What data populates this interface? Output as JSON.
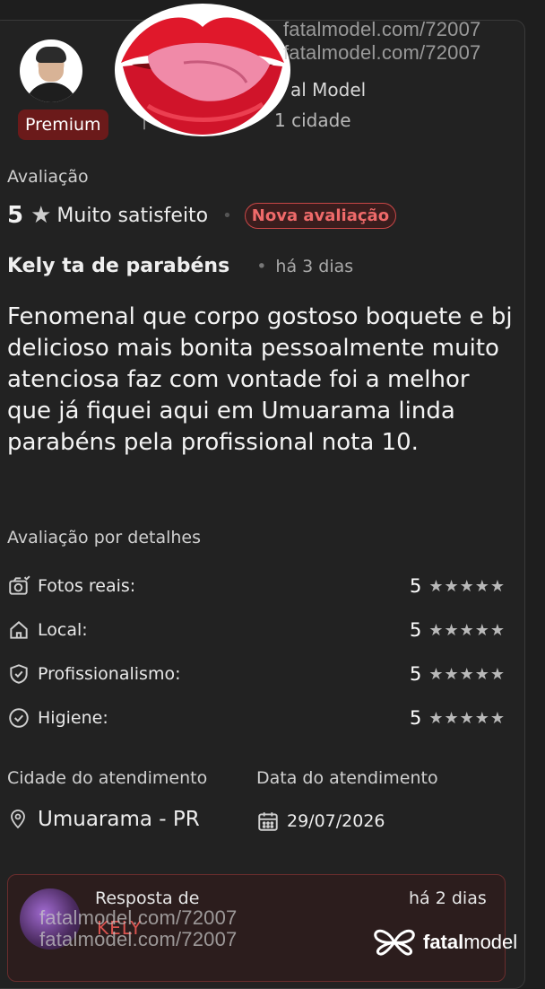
{
  "header": {
    "badge": "Premium",
    "meta_line_1": "al Model",
    "meta_line_2": "1 cidade",
    "meta_pipe": "|"
  },
  "watermark": {
    "text": "fatalmodel.com/72007"
  },
  "rating": {
    "section_label": "Avaliação",
    "score": "5",
    "text": "Muito satisfeito",
    "new_badge": "Nova avaliação"
  },
  "review": {
    "title": "Kely ta de parabéns",
    "time": "há 3 dias",
    "body": "Fenomenal que corpo gostoso boquete e bj delicioso mais bonita pessoalmente muito atenciosa faz com vontade foi a melhor que já fiquei aqui em Umuarama linda parabéns pela profissional nota 10."
  },
  "details": {
    "label": "Avaliação por detalhes",
    "items": [
      {
        "label": "Fotos reais:",
        "score": "5",
        "stars": "★★★★★",
        "icon": "camera-icon"
      },
      {
        "label": "Local:",
        "score": "5",
        "stars": "★★★★★",
        "icon": "home-icon"
      },
      {
        "label": "Profissionalismo:",
        "score": "5",
        "stars": "★★★★★",
        "icon": "shield-check-icon"
      },
      {
        "label": "Higiene:",
        "score": "5",
        "stars": "★★★★★",
        "icon": "check-circle-icon"
      }
    ]
  },
  "service": {
    "city_label": "Cidade do atendimento",
    "city_value": "Umuarama - PR",
    "date_label": "Data do atendimento",
    "date_value": "29/07/2026"
  },
  "response": {
    "label": "Resposta de",
    "name": "KELY",
    "time": "há 2 dias"
  },
  "brand": {
    "name_part1": "fatal",
    "name_part2": "model"
  },
  "colors": {
    "background": "#1e1e1e",
    "accent_red": "#c84747",
    "premium_bg": "#6b1a1a"
  }
}
